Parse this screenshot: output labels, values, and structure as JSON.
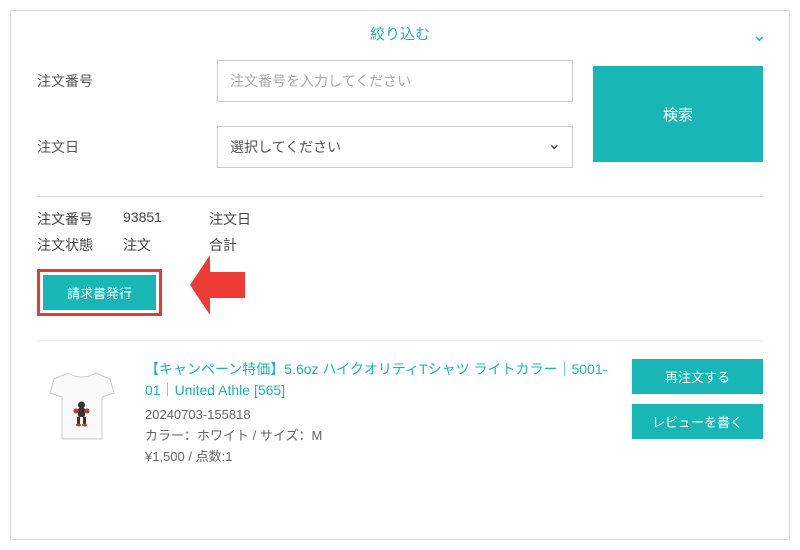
{
  "filter": {
    "title": "絞り込む",
    "order_number_label": "注文番号",
    "order_number_placeholder": "注文番号を入力してください",
    "order_date_label": "注文日",
    "order_date_placeholder": "選択してください",
    "search_button": "検索"
  },
  "order_meta": {
    "order_number_label": "注文番号",
    "order_number_value": "93851",
    "order_date_label": "注文日",
    "order_date_value": "",
    "status_label": "注文状態",
    "status_value": "注文",
    "total_label": "合計"
  },
  "invoice_button": "請求書発行",
  "item": {
    "title": "【キャンペーン特価】5.6oz ハイクオリティTシャツ ライトカラー｜5001-01｜United Athle [565]",
    "code": "20240703-155818",
    "spec": "カラー：ホワイト / サイズ：M",
    "price_qty": "¥1,500 / 点数:1"
  },
  "actions": {
    "reorder": "再注文する",
    "review": "レビューを書く"
  }
}
